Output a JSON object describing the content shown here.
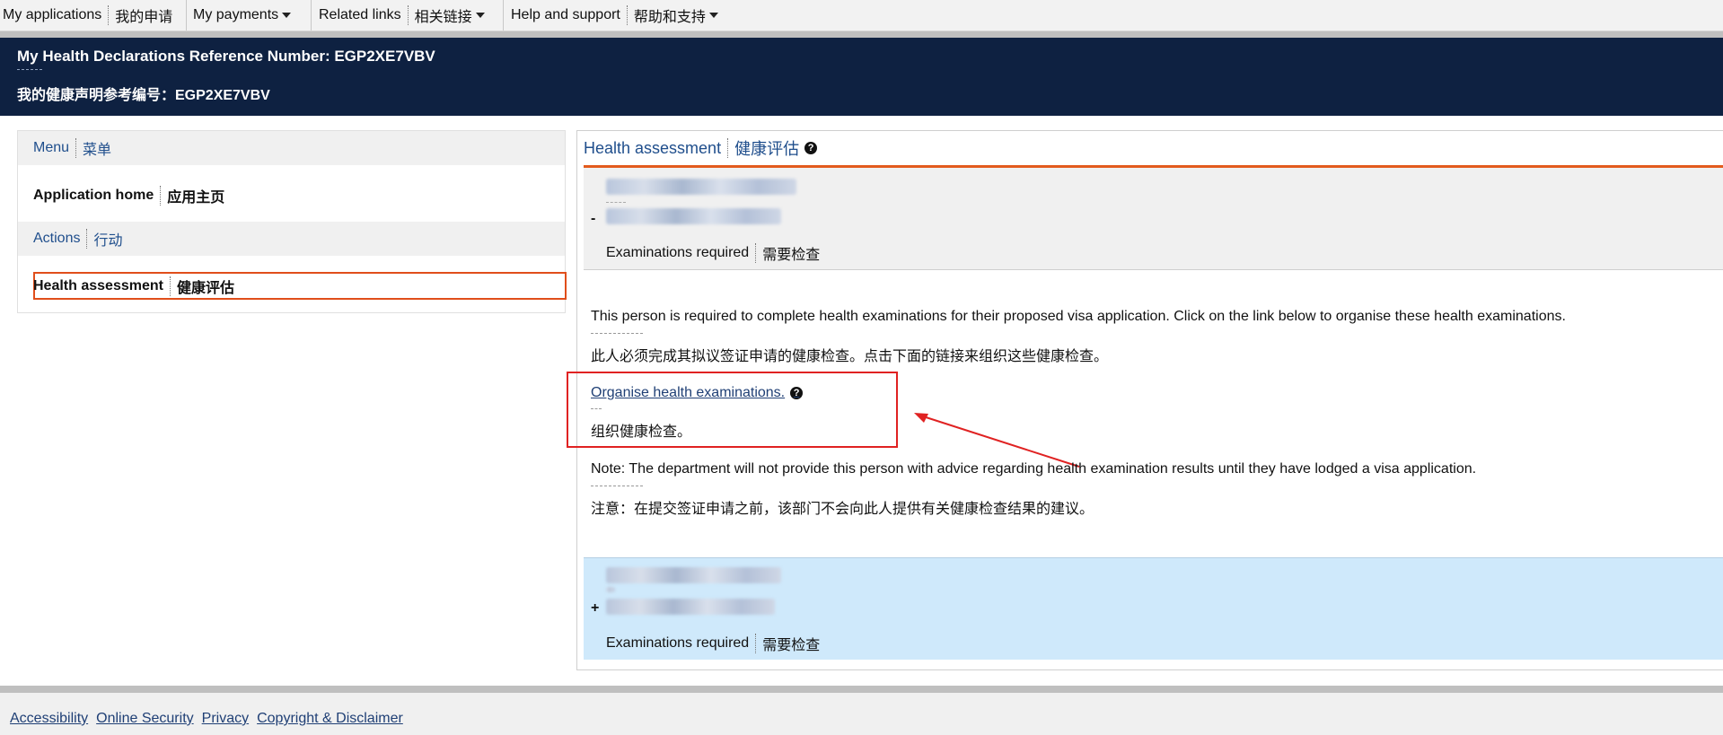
{
  "topnav": {
    "my_applications": "My applications",
    "my_applications_cn": "我的申请",
    "my_payments": "My payments",
    "related_links": "Related links",
    "related_links_cn": "相关链接",
    "help_support": "Help and support",
    "help_support_cn": "帮助和支持"
  },
  "header": {
    "ref_en": "My Health Declarations Reference Number: EGP2XE7VBV",
    "ref_cn": "我的健康声明参考编号：EGP2XE7VBV"
  },
  "sidebar": {
    "menu": "Menu",
    "menu_cn": "菜单",
    "app_home": "Application home",
    "app_home_cn": "应用主页",
    "actions": "Actions",
    "actions_cn": "行动",
    "health_assessment": "Health assessment",
    "health_assessment_cn": "健康评估"
  },
  "main": {
    "title": "Health assessment",
    "title_cn": "健康评估",
    "person1": {
      "toggle": "-",
      "status": "Examinations required",
      "status_cn": "需要检查"
    },
    "required_text": "This person is required to complete health examinations for their proposed visa application. Click on the link below to organise these health examinations.",
    "required_text_cn": "此人必须完成其拟议签证申请的健康检查。点击下面的链接来组织这些健康检查。",
    "organise_link": "Organise health examinations.",
    "organise_link_cn": "组织健康检查。",
    "note": "Note: The department will not provide this person with advice regarding health examination results until they have lodged a visa application.",
    "note_cn": "注意：在提交签证申请之前，该部门不会向此人提供有关健康检查结果的建议。",
    "person2": {
      "toggle": "+",
      "status": "Examinations required",
      "status_cn": "需要检查"
    }
  },
  "footer": {
    "accessibility": "Accessibility",
    "online_security": "Online Security",
    "privacy": "Privacy",
    "copyright": "Copyright & Disclaimer"
  },
  "colors": {
    "header_bg": "#0e2141",
    "link": "#1f4e8c",
    "accent_orange": "#e35b1d",
    "annotation_red": "#e02222",
    "person2_bg": "#cfe9fb"
  }
}
